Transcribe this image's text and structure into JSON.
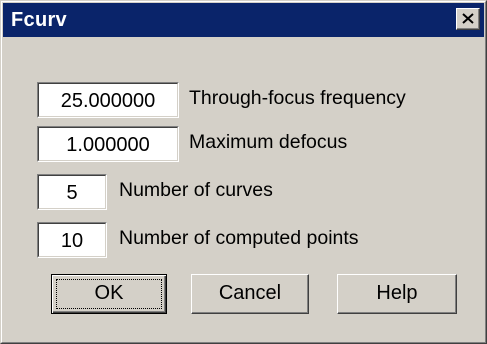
{
  "window": {
    "title": "Fcurv",
    "title_bar_color": "#0a246a",
    "face_color": "#d4d0c8"
  },
  "close_button": {
    "icon": "close-icon"
  },
  "fields": [
    {
      "value": "25.000000",
      "label": "Through-focus frequency"
    },
    {
      "value": "1.000000",
      "label": "Maximum defocus"
    },
    {
      "value": "5",
      "label": "Number of curves"
    },
    {
      "value": "10",
      "label": "Number of computed points"
    }
  ],
  "buttons": {
    "ok": "OK",
    "cancel": "Cancel",
    "help": "Help"
  }
}
